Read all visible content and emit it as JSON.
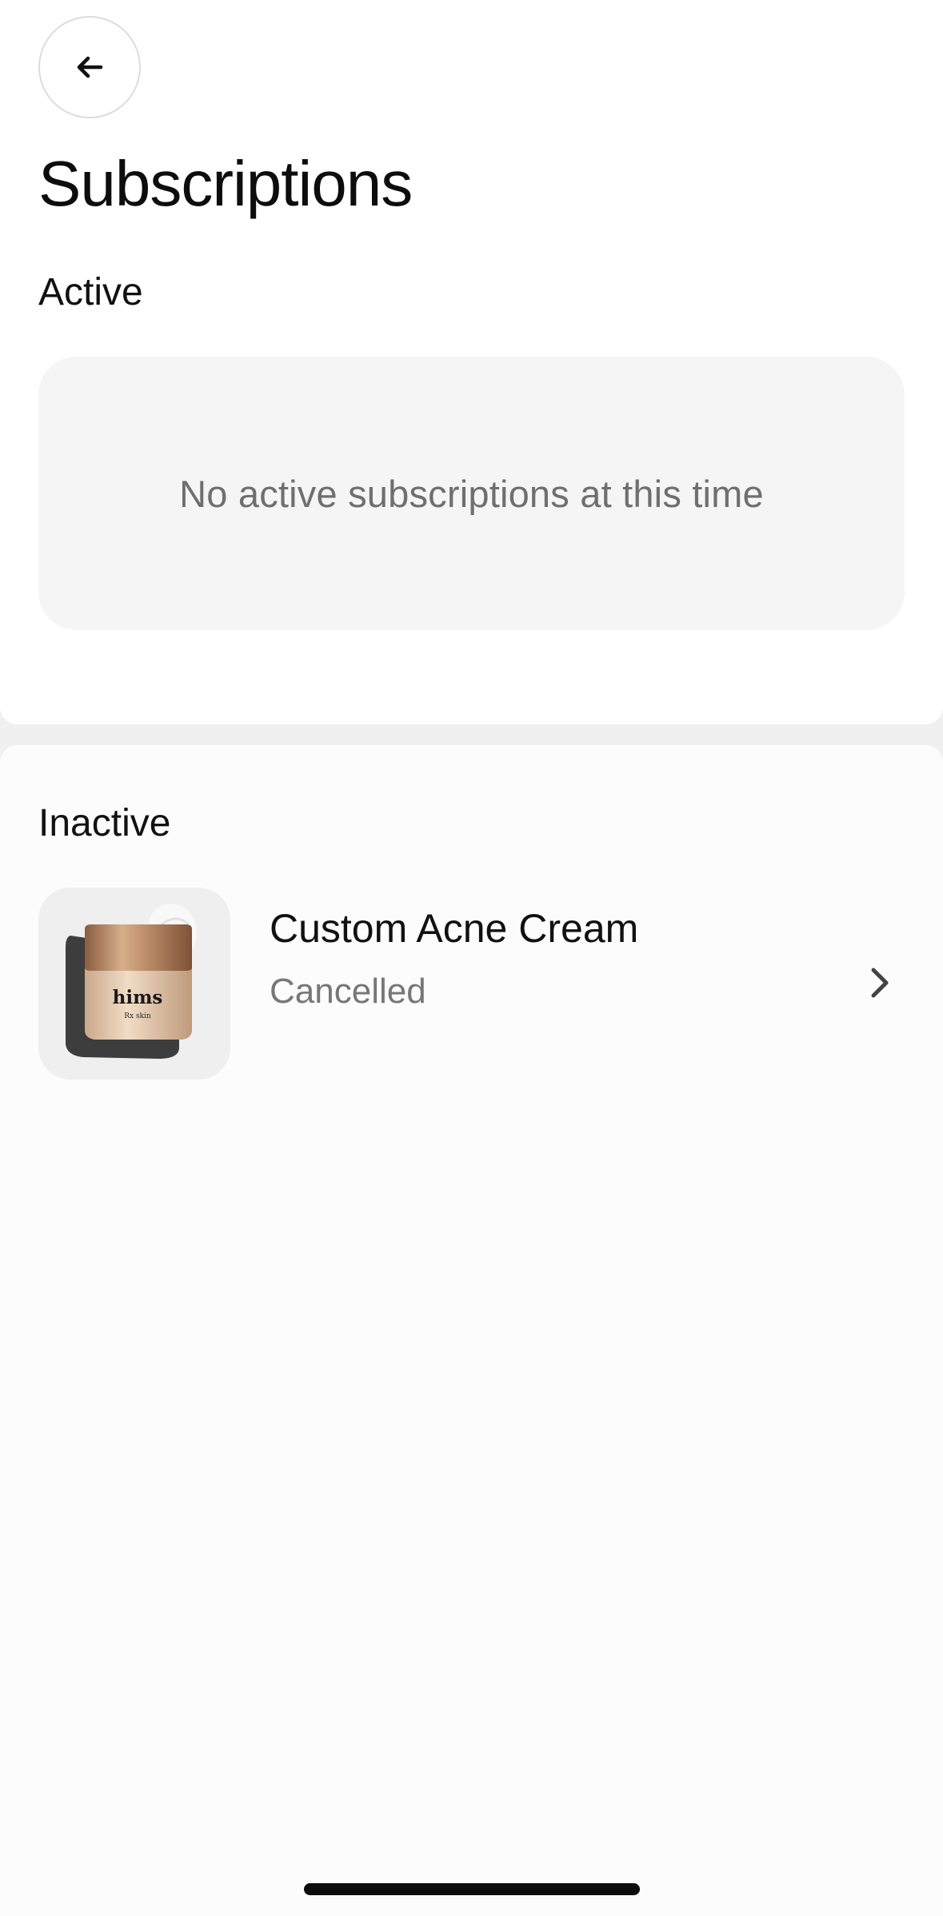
{
  "header": {
    "back_icon": "arrow-left-icon",
    "title": "Subscriptions"
  },
  "active_section": {
    "label": "Active",
    "empty_message": "No active subscriptions at this time"
  },
  "inactive_section": {
    "label": "Inactive",
    "items": [
      {
        "name": "Custom Acne Cream",
        "status": "Cancelled",
        "image_icon": "acne-cream-jar-image",
        "jar_brand": "hims",
        "jar_subtitle": "Rx skin",
        "chevron_icon": "chevron-right-icon"
      }
    ]
  },
  "colors": {
    "background": "#f0f0f0",
    "panel": "#ffffff",
    "empty_card": "#f5f5f5",
    "muted_text": "#6f6f6f",
    "jar_gold": "#b48a6a"
  }
}
